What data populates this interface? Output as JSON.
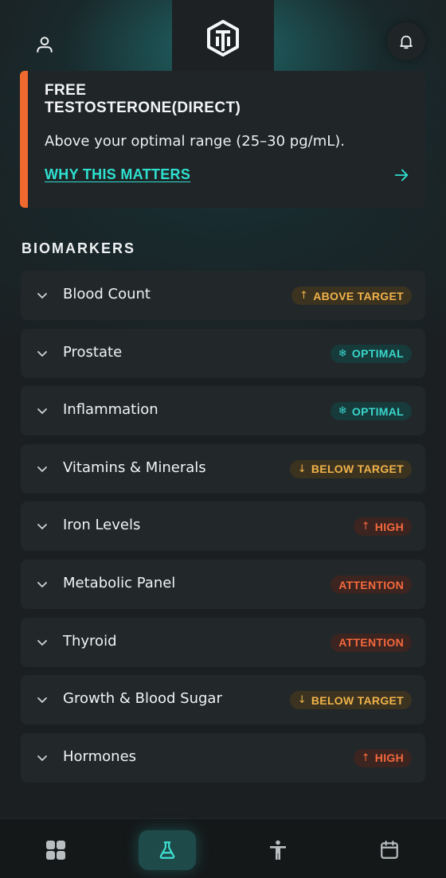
{
  "topbar": {
    "user_icon": "user-icon",
    "bell_icon": "bell-icon",
    "logo_icon": "brand-logo-icon"
  },
  "alert": {
    "title": "FREE TESTOSTERONE(DIRECT)",
    "message": "Above your optimal range (25–30 pg/mL).",
    "link_label": "WHY THIS MATTERS",
    "link_icon": "arrow-right-icon",
    "accent_color": "#f0692e"
  },
  "biomarkers": {
    "section_title": "BIOMARKERS",
    "items": [
      {
        "label": "Blood Count",
        "status": "ABOVE TARGET",
        "status_type": "above",
        "status_icon": "↑"
      },
      {
        "label": "Prostate",
        "status": "OPTIMAL",
        "status_type": "optimal",
        "status_icon": "❄"
      },
      {
        "label": "Inflammation",
        "status": "OPTIMAL",
        "status_type": "optimal",
        "status_icon": "❄"
      },
      {
        "label": "Vitamins & Minerals",
        "status": "BELOW TARGET",
        "status_type": "below",
        "status_icon": "↓"
      },
      {
        "label": "Iron Levels",
        "status": "HIGH",
        "status_type": "high",
        "status_icon": "↑"
      },
      {
        "label": "Metabolic Panel",
        "status": "ATTENTION",
        "status_type": "attention",
        "status_icon": ""
      },
      {
        "label": "Thyroid",
        "status": "ATTENTION",
        "status_type": "attention",
        "status_icon": ""
      },
      {
        "label": "Growth & Blood Sugar",
        "status": "BELOW TARGET",
        "status_type": "below",
        "status_icon": "↓"
      },
      {
        "label": "Hormones",
        "status": "HIGH",
        "status_type": "high",
        "status_icon": "↑"
      }
    ]
  },
  "bottom_nav": {
    "items": [
      {
        "name": "dashboard-grid-icon",
        "active": false
      },
      {
        "name": "lab-flask-icon",
        "active": true
      },
      {
        "name": "body-figure-icon",
        "active": false
      },
      {
        "name": "calendar-icon",
        "active": false
      }
    ]
  },
  "colors": {
    "background": "#1b1f21",
    "card": "#22272a",
    "teal_accent": "#2ee0d0",
    "warning": "#f0b24a",
    "danger": "#f4693d"
  }
}
